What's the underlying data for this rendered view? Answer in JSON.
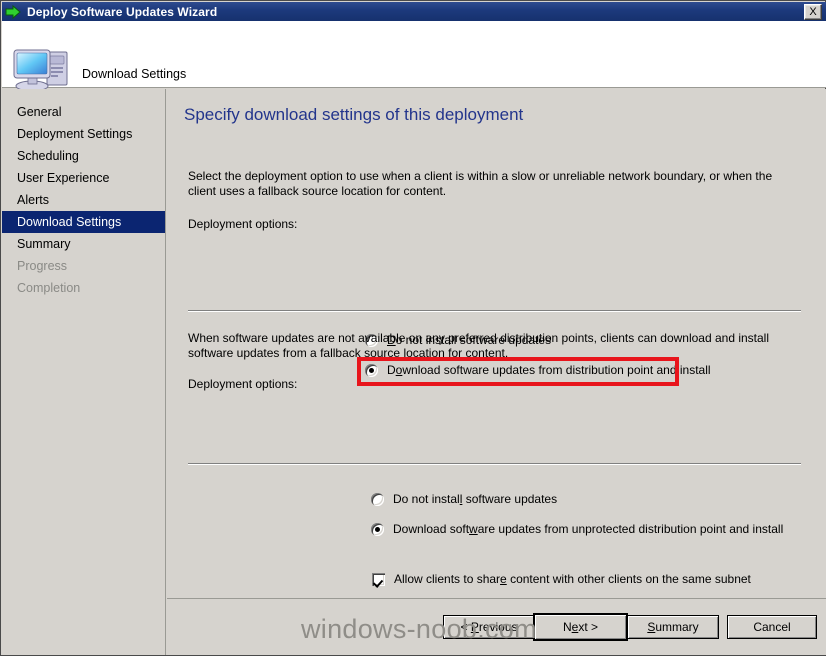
{
  "window": {
    "title": "Deploy Software Updates Wizard",
    "title_icon": "green-arrow-icon",
    "close_label": "X",
    "accent_title_bar": "#1d3a7d"
  },
  "header": {
    "icon": "computer-monitor-icon",
    "title": "Download Settings"
  },
  "sidebar": {
    "items": [
      {
        "label": "General",
        "state": "normal"
      },
      {
        "label": "Deployment Settings",
        "state": "normal"
      },
      {
        "label": "Scheduling",
        "state": "normal"
      },
      {
        "label": "User Experience",
        "state": "normal"
      },
      {
        "label": "Alerts",
        "state": "normal"
      },
      {
        "label": "Download Settings",
        "state": "selected"
      },
      {
        "label": "Summary",
        "state": "normal"
      },
      {
        "label": "Progress",
        "state": "disabled"
      },
      {
        "label": "Completion",
        "state": "disabled"
      }
    ],
    "selected_color": "#0b2571"
  },
  "content": {
    "heading": "Specify download settings of this deployment",
    "heading_color": "#23358c",
    "intro_text": "Select the deployment option to use when a client is within a slow or unreliable network boundary, or when the client uses a fallback source location for content.",
    "label_options_1": "Deployment options:",
    "radio_group_1": [
      {
        "label": "Do not install software updates",
        "checked": false
      },
      {
        "label": "Download software updates from distribution point and install",
        "checked": true
      }
    ],
    "mid_text": "When software updates are not available on any preferred distribution points, clients can download and install software updates from a fallback source location for content.",
    "label_options_2": "Deployment options:",
    "radio_group_2": [
      {
        "label": "Do not install software updates",
        "checked": false
      },
      {
        "label": "Download software updates from unprotected distribution point and install",
        "checked": true
      }
    ],
    "checkbox": {
      "label": "Allow clients to share content with other clients on the same subnet",
      "checked": true
    }
  },
  "annotation": {
    "color": "#e8151c",
    "targets": "Download software updates from distribution point and install"
  },
  "footer": {
    "buttons": [
      {
        "label": "< Previous",
        "default": false
      },
      {
        "label": "Next >",
        "default": true
      },
      {
        "label": "Summary",
        "default": false
      },
      {
        "label": "Cancel",
        "default": false
      }
    ]
  },
  "watermark": {
    "text": "windows-noob.com",
    "color": "#8f8d88"
  }
}
